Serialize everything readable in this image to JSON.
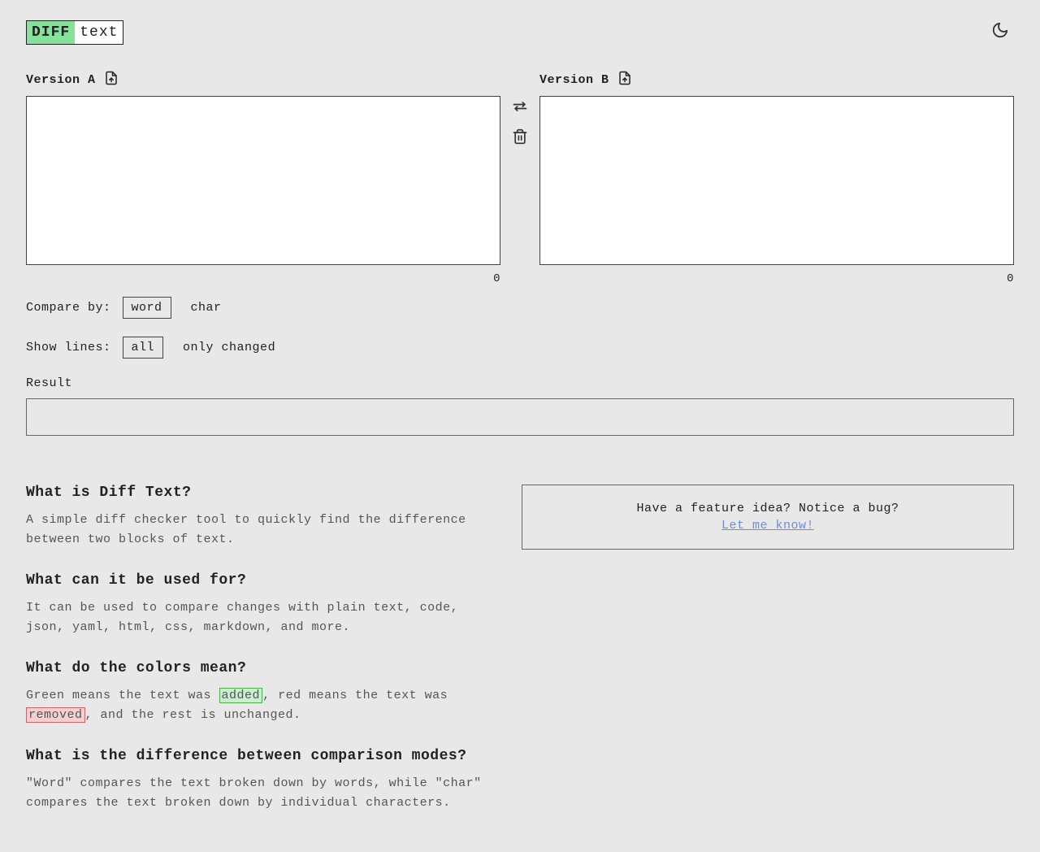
{
  "logo": {
    "part1": "DIFF",
    "part2": "text"
  },
  "versions": {
    "a": {
      "label": "Version A",
      "value": "",
      "count": "0"
    },
    "b": {
      "label": "Version B",
      "value": "",
      "count": "0"
    }
  },
  "controls": {
    "compare_by_label": "Compare by:",
    "compare_options": {
      "word": "word",
      "char": "char"
    },
    "show_lines_label": "Show lines:",
    "show_options": {
      "all": "all",
      "only_changed": "only changed"
    }
  },
  "result": {
    "label": "Result"
  },
  "info": {
    "q1": "What is Diff Text?",
    "a1": "A simple diff checker tool to quickly find the difference between two blocks of text.",
    "q2": "What can it be used for?",
    "a2": "It can be used to compare changes with plain text, code, json, yaml, html, css, markdown, and more.",
    "q3": "What do the colors mean?",
    "a3_pre": "Green means the text was ",
    "a3_added": "added",
    "a3_mid": ", red means the text was ",
    "a3_removed": "removed",
    "a3_post": ", and the rest is unchanged.",
    "q4": "What is the difference between comparison modes?",
    "a4": "\"Word\" compares the text broken down by words, while \"char\" compares the text broken down by individual characters."
  },
  "feedback": {
    "line1": "Have a feature idea? Notice a bug?",
    "link": "Let me know!"
  }
}
